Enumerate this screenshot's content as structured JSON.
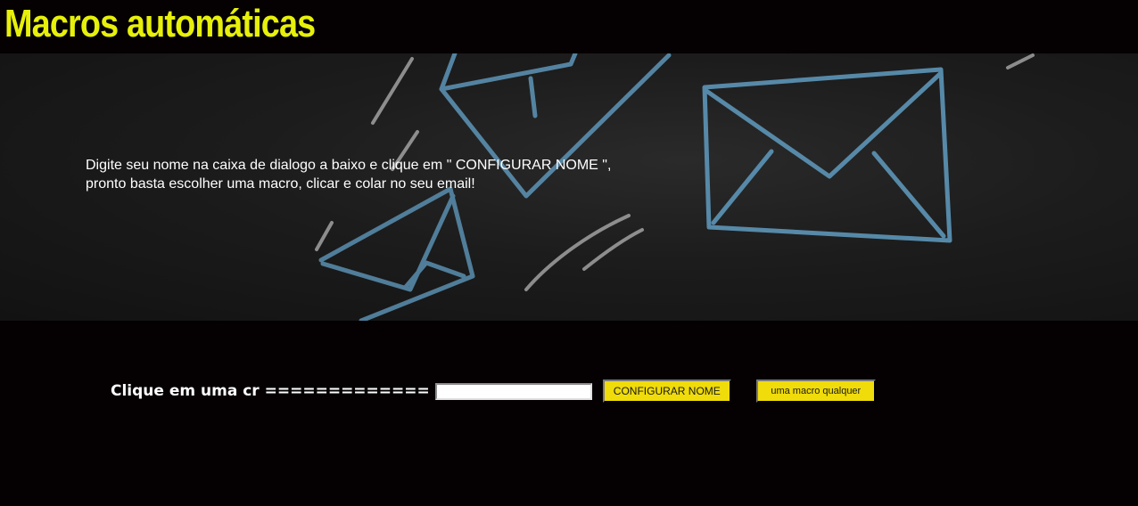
{
  "header": {
    "title": "Macros automáticas"
  },
  "banner": {
    "instructions": "Digite seu nome na caixa de dialogo a baixo e clique em \" CONFIGURAR NOME \", pronto basta escolher uma macro, clicar e colar no seu email!"
  },
  "controls": {
    "label": "Clique em uma cr =============",
    "name_input_value": "",
    "name_input_placeholder": "",
    "configure_button_label": "CONFIGURAR NOME",
    "macro_button_label": "uma macro qualquer"
  },
  "colors": {
    "title": "#e6f00a",
    "button_bg": "#f0dc0a",
    "page_bg": "#050102",
    "envelope_chalk": "#5a8fb0"
  }
}
